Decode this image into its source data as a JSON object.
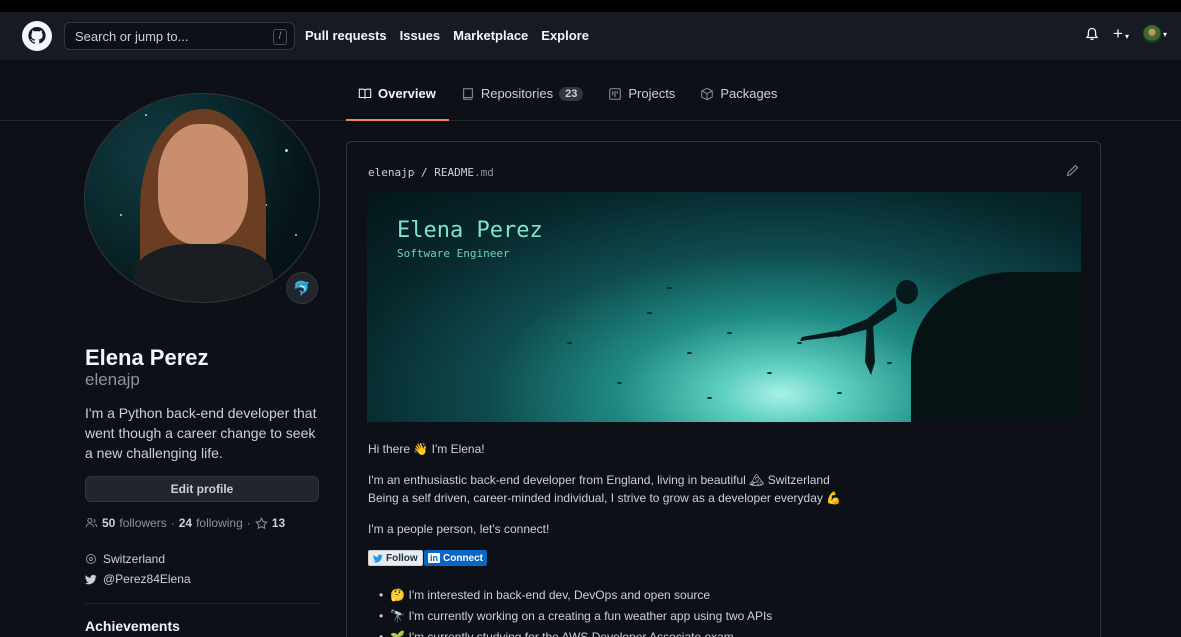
{
  "header": {
    "search_placeholder": "Search or jump to...",
    "search_shortcut": "/",
    "nav": [
      "Pull requests",
      "Issues",
      "Marketplace",
      "Explore"
    ]
  },
  "tabs": [
    {
      "label": "Overview",
      "icon": "book-icon",
      "active": true
    },
    {
      "label": "Repositories",
      "icon": "repo-icon",
      "count": "23"
    },
    {
      "label": "Projects",
      "icon": "project-icon"
    },
    {
      "label": "Packages",
      "icon": "package-icon"
    }
  ],
  "profile": {
    "name": "Elena Perez",
    "login": "elenajp",
    "bio": "I'm a Python back-end developer that went though a career change to seek a new challenging life.",
    "edit_label": "Edit profile",
    "followers_count": "50",
    "followers_label": "followers",
    "following_count": "24",
    "following_label": "following",
    "stars_count": "13",
    "location": "Switzerland",
    "twitter": "@Perez84Elena",
    "achievements_label": "Achievements"
  },
  "readme": {
    "owner": "elenajp",
    "file": "README",
    "ext": ".md",
    "banner_title": "Elena Perez",
    "banner_subtitle": "Software Engineer",
    "greeting": "Hi there 👋 I'm Elena!",
    "intro_line1": "I'm an enthusiastic back-end developer from England, living in beautiful 🏔 Switzerland",
    "intro_line2": "Being a self driven, career-minded individual, I strive to grow as a developer everyday 💪",
    "connect": "I'm a people person, let's connect!",
    "follow_badge": "Follow",
    "connect_badge": "Connect",
    "bullets": [
      "🤔 I'm interested in back-end dev, DevOps and open source",
      "🔭 I'm currently working on a creating a fun weather app using two APIs",
      "🌱 I'm currently studying for the AWS Developer Associate exam"
    ]
  },
  "colors": {
    "accent_underline": "#f78166",
    "linkedin": "#0a66c2"
  }
}
